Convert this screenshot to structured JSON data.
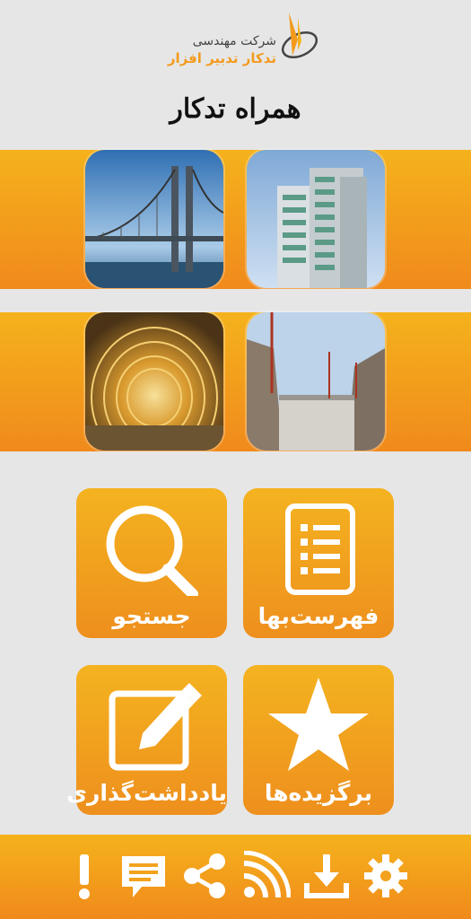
{
  "brand": {
    "line1": "شرکت مهندسی",
    "line2": "تدکار تدبیر افزار"
  },
  "app_title": "همراه تدکار",
  "gallery": [
    {
      "name": "building",
      "icon": "building-photo"
    },
    {
      "name": "bridge",
      "icon": "bridge-photo"
    },
    {
      "name": "dam",
      "icon": "dam-photo"
    },
    {
      "name": "tunnel",
      "icon": "tunnel-photo"
    }
  ],
  "menu": {
    "price_list_label": "فهرست‌بها",
    "search_label": "جستجو",
    "favorites_label": "برگزیده‌ها",
    "notes_label": "یادداشت‌گذاری"
  },
  "toolbar": [
    {
      "name": "settings",
      "icon": "gear-icon"
    },
    {
      "name": "download",
      "icon": "download-icon"
    },
    {
      "name": "rss",
      "icon": "rss-icon"
    },
    {
      "name": "share",
      "icon": "share-icon"
    },
    {
      "name": "message",
      "icon": "message-icon"
    },
    {
      "name": "about",
      "icon": "exclamation-icon"
    }
  ],
  "colors": {
    "accent": "#f39a1e",
    "accent_light": "#f5b21c",
    "background": "#e6e6e6"
  }
}
